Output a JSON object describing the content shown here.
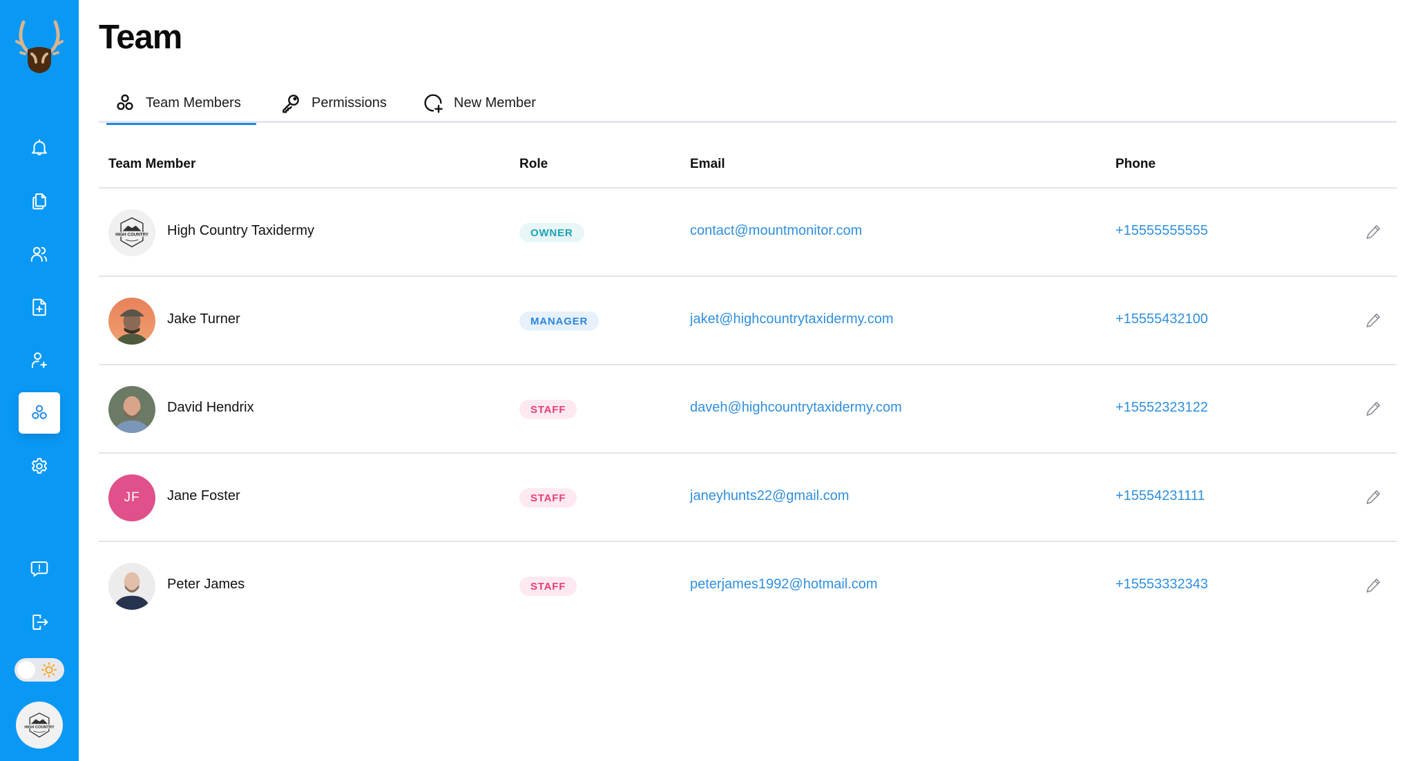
{
  "app": {
    "brand_logo": "antler-mount-logo",
    "accent_color": "#0A98F5"
  },
  "sidebar": {
    "items": [
      {
        "id": "notifications",
        "icon": "bell-icon"
      },
      {
        "id": "documents",
        "icon": "files-icon"
      },
      {
        "id": "customers",
        "icon": "users-icon"
      },
      {
        "id": "new-document",
        "icon": "file-plus-icon"
      },
      {
        "id": "add-user",
        "icon": "user-plus-icon"
      },
      {
        "id": "team",
        "icon": "team-circles-icon",
        "active": true
      },
      {
        "id": "settings",
        "icon": "gear-icon"
      },
      {
        "id": "feedback",
        "icon": "message-alert-icon"
      },
      {
        "id": "logout",
        "icon": "logout-icon"
      }
    ],
    "theme_toggle": {
      "mode": "light",
      "icon": "sun-icon"
    },
    "profile": {
      "label": "HIGH COUNTRY"
    }
  },
  "header": {
    "title": "Team"
  },
  "tabs": [
    {
      "label": "Team Members",
      "icon": "team-circles-icon",
      "active": true
    },
    {
      "label": "Permissions",
      "icon": "key-icon",
      "active": false
    },
    {
      "label": "New Member",
      "icon": "circle-plus-icon",
      "active": false
    }
  ],
  "table": {
    "columns": [
      "Team Member",
      "Role",
      "Email",
      "Phone"
    ],
    "rows": [
      {
        "name": "High Country Taxidermy",
        "role": "OWNER",
        "email": "contact@mountmonitor.com",
        "phone": "+15555555555",
        "avatar": "logo",
        "avatar_label": "HIGH COUNTRY"
      },
      {
        "name": "Jake Turner",
        "role": "MANAGER",
        "email": "jaket@highcountrytaxidermy.com",
        "phone": "+15555432100",
        "avatar": "photo"
      },
      {
        "name": "David Hendrix",
        "role": "STAFF",
        "email": "daveh@highcountrytaxidermy.com",
        "phone": "+15552323122",
        "avatar": "photo"
      },
      {
        "name": "Jane Foster",
        "role": "STAFF",
        "email": "janeyhunts22@gmail.com",
        "phone": "+15554231111",
        "avatar": "initials",
        "initials": "JF",
        "avatar_color": "#E0508A"
      },
      {
        "name": "Peter James",
        "role": "STAFF",
        "email": "peterjames1992@hotmail.com",
        "phone": "+15553332343",
        "avatar": "photo"
      }
    ]
  },
  "role_colors": {
    "OWNER": "#1AA3B6",
    "MANAGER": "#2A86DC",
    "STAFF": "#E43F76"
  }
}
